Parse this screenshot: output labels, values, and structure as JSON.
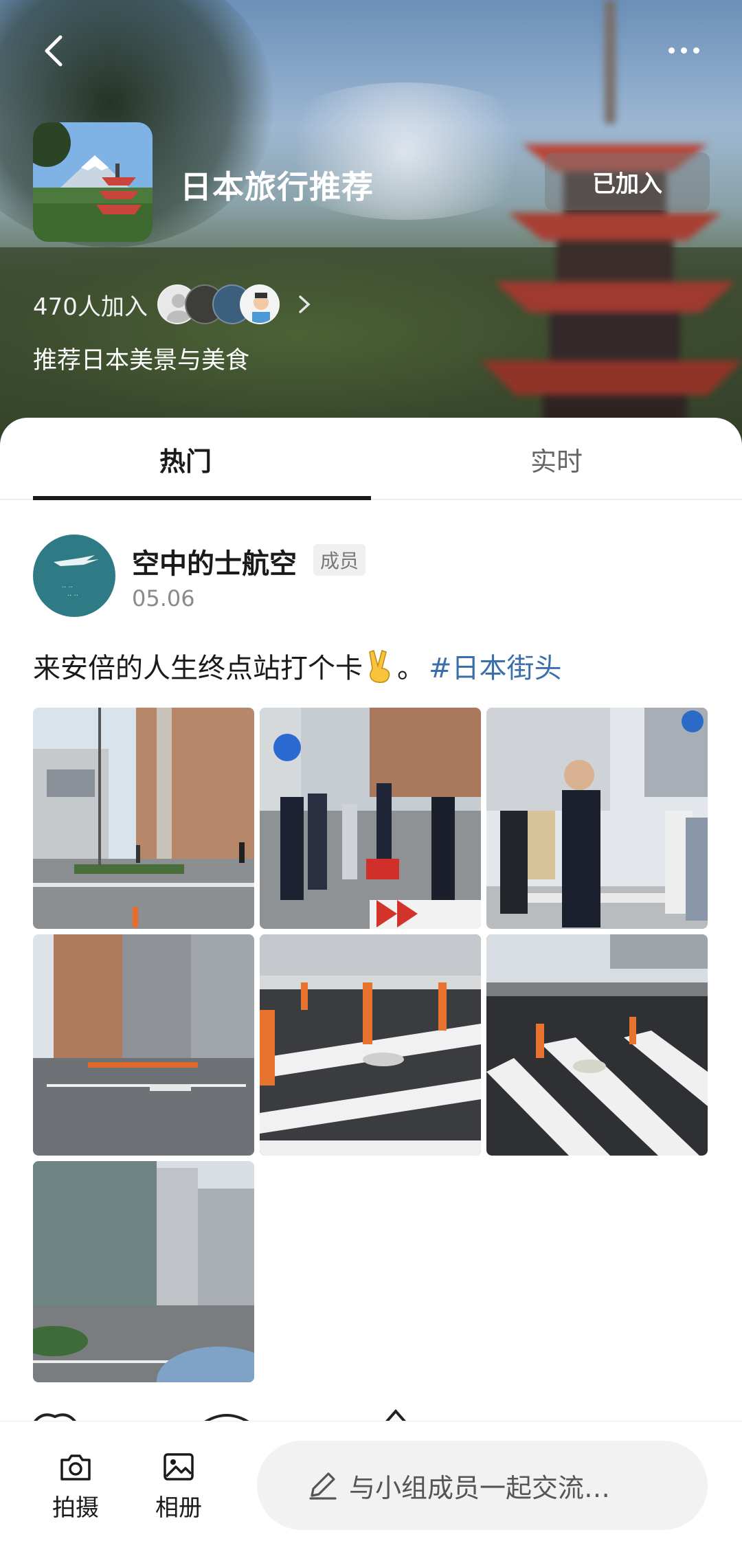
{
  "group": {
    "title": "日本旅行推荐",
    "join_button": "已加入",
    "members_count": "470人加入",
    "description": "推荐日本美景与美食"
  },
  "tabs": [
    {
      "label": "热门",
      "active": true
    },
    {
      "label": "实时",
      "active": false
    }
  ],
  "post": {
    "author": "空中的士航空",
    "badge": "成员",
    "date": "05.06",
    "text": "来安倍的人生终点站打个卡",
    "emoji": "victory-hand-icon",
    "suffix": "。",
    "hashtag": "#日本街头",
    "photo_count": 7
  },
  "bottom_bar": {
    "camera_label": "拍摄",
    "album_label": "相册",
    "compose_placeholder": "与小组成员一起交流…"
  },
  "colors": {
    "accent_link": "#3a6fae",
    "text_primary": "#1a1a1a",
    "text_secondary": "#8a8a8a"
  }
}
